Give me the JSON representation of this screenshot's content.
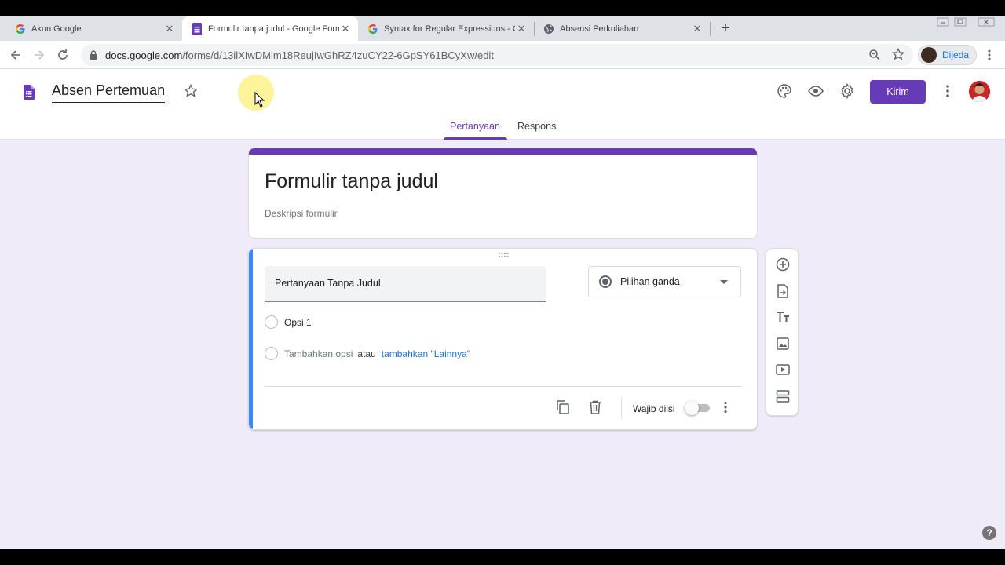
{
  "browser": {
    "tabs": [
      {
        "title": "Akun Google",
        "favicon": "google-g-icon",
        "active": false
      },
      {
        "title": "Formulir tanpa judul - Google Formulir",
        "favicon": "google-forms-icon",
        "active": true
      },
      {
        "title": "Syntax for Regular Expressions - Go",
        "favicon": "google-g-icon",
        "active": false
      },
      {
        "title": "Absensi Perkuliahan",
        "favicon": "globe-icon",
        "active": false
      }
    ],
    "tab_close": "✕",
    "new_tab": "+",
    "url_host": "docs.google.com",
    "url_path": "/forms/d/13ilXIwDMlm18ReujIwGhRZ4zuCY22-6GpSY61BCyXw/edit",
    "profile_name": "Dijeda"
  },
  "header": {
    "doc_title": "Absen Pertemuan",
    "tabs": [
      {
        "label": "Pertanyaan",
        "active": true
      },
      {
        "label": "Respons",
        "active": false
      }
    ],
    "send_label": "Kirim"
  },
  "form": {
    "title": "Formulir tanpa judul",
    "description_placeholder": "Deskripsi formulir"
  },
  "question": {
    "title": "Pertanyaan Tanpa Judul",
    "type": "Pilihan ganda",
    "options": [
      "Opsi 1"
    ],
    "add_option": "Tambahkan opsi",
    "or_text": "atau",
    "add_other": "tambahkan \"Lainnya\"",
    "required_label": "Wajib diisi",
    "required": false
  },
  "help_label": "?",
  "colors": {
    "accent": "#673ab7",
    "background": "#f0ebf8",
    "question_bar": "#4285f4",
    "link": "#1a73e8"
  }
}
